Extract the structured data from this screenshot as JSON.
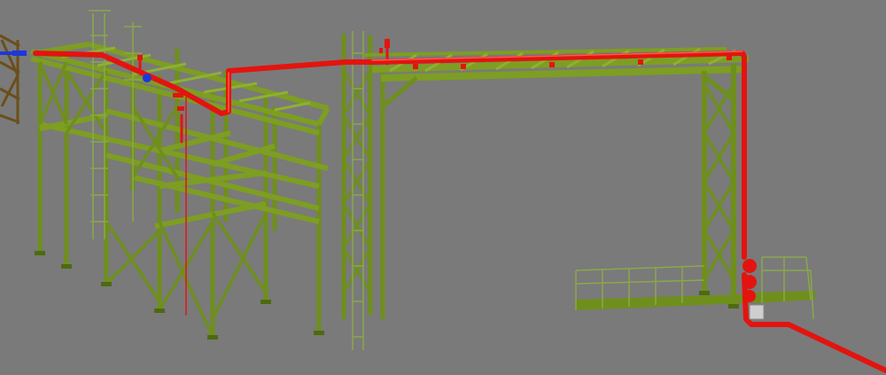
{
  "scene": {
    "background": "#7a7a7a",
    "structure_color": "#6f8f1c",
    "structure_dark": "#4e6a10",
    "structure_light": "#8fb032",
    "pipe_color": "#e3140f",
    "pipe_highlight": "#ff5a4a",
    "flange_blue": "#1c38d8",
    "ladder_color": "#8aa84a",
    "equipment_grey": "#cfcfcf"
  },
  "icons": {
    "valve": "valve-icon",
    "flange": "flange-icon"
  }
}
